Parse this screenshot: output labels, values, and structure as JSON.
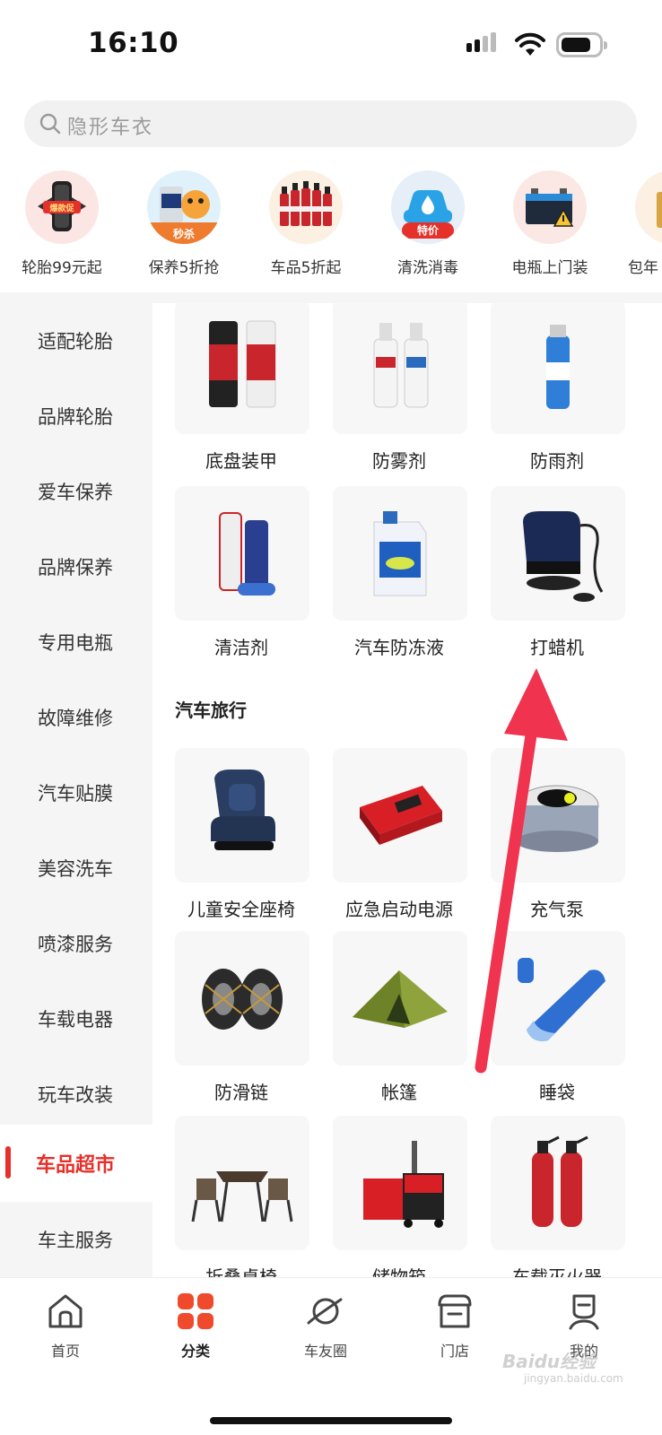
{
  "status_bar": {
    "time": "16:10"
  },
  "search": {
    "placeholder": "隐形车衣"
  },
  "quick_categories": [
    {
      "label": "轮胎99元起",
      "badge": "爆款促",
      "icon": "tire-icon"
    },
    {
      "label": "保养5折抢",
      "badge": "秒杀",
      "icon": "motor-oil-icon"
    },
    {
      "label": "车品5折起",
      "badge": "",
      "icon": "fuel-additive-icon"
    },
    {
      "label": "清洗消毒",
      "badge": "特价",
      "icon": "car-wash-icon"
    },
    {
      "label": "电瓶上门装",
      "badge": "",
      "icon": "battery-icon"
    },
    {
      "label": "包年",
      "badge": "",
      "icon": "package-icon"
    }
  ],
  "sidebar": {
    "items": [
      {
        "label": "适配轮胎"
      },
      {
        "label": "品牌轮胎"
      },
      {
        "label": "爱车保养"
      },
      {
        "label": "品牌保养"
      },
      {
        "label": "专用电瓶"
      },
      {
        "label": "故障维修"
      },
      {
        "label": "汽车贴膜"
      },
      {
        "label": "美容洗车"
      },
      {
        "label": "喷漆服务"
      },
      {
        "label": "车载电器"
      },
      {
        "label": "玩车改装"
      },
      {
        "label": "车品超市"
      },
      {
        "label": "车主服务"
      }
    ],
    "active": "车品超市"
  },
  "content": {
    "group1": [
      {
        "label": "底盘装甲",
        "icon": "spray-can-icon"
      },
      {
        "label": "防雾剂",
        "icon": "spray-bottle-icon"
      },
      {
        "label": "防雨剂",
        "icon": "aerosol-icon"
      },
      {
        "label": "清洁剂",
        "icon": "cleaner-icon"
      },
      {
        "label": "汽车防冻液",
        "icon": "antifreeze-icon"
      },
      {
        "label": "打蜡机",
        "icon": "polisher-icon"
      }
    ],
    "section_title": "汽车旅行",
    "group2": [
      {
        "label": "儿童安全座椅",
        "icon": "child-seat-icon"
      },
      {
        "label": "应急启动电源",
        "icon": "jump-starter-icon"
      },
      {
        "label": "充气泵",
        "icon": "air-pump-icon"
      },
      {
        "label": "防滑链",
        "icon": "snow-chain-icon"
      },
      {
        "label": "帐篷",
        "icon": "tent-icon"
      },
      {
        "label": "睡袋",
        "icon": "sleeping-bag-icon"
      },
      {
        "label": "折叠桌椅",
        "icon": "folding-table-icon"
      },
      {
        "label": "储物箱",
        "icon": "storage-box-icon"
      },
      {
        "label": "车载灭火器",
        "icon": "extinguisher-icon"
      }
    ]
  },
  "tab_bar": {
    "tabs": [
      {
        "label": "首页",
        "icon": "home-icon"
      },
      {
        "label": "分类",
        "icon": "category-grid-icon"
      },
      {
        "label": "车友圈",
        "icon": "planet-icon"
      },
      {
        "label": "门店",
        "icon": "store-icon"
      },
      {
        "label": "我的",
        "icon": "profile-icon"
      }
    ],
    "active": "分类"
  },
  "watermark": {
    "text": "Baidu经验",
    "sub": "jingyan.baidu.com"
  },
  "colors": {
    "accent": "#e5312a",
    "sidebar_bg": "#f5f5f5",
    "arrow": "#f0334f"
  }
}
